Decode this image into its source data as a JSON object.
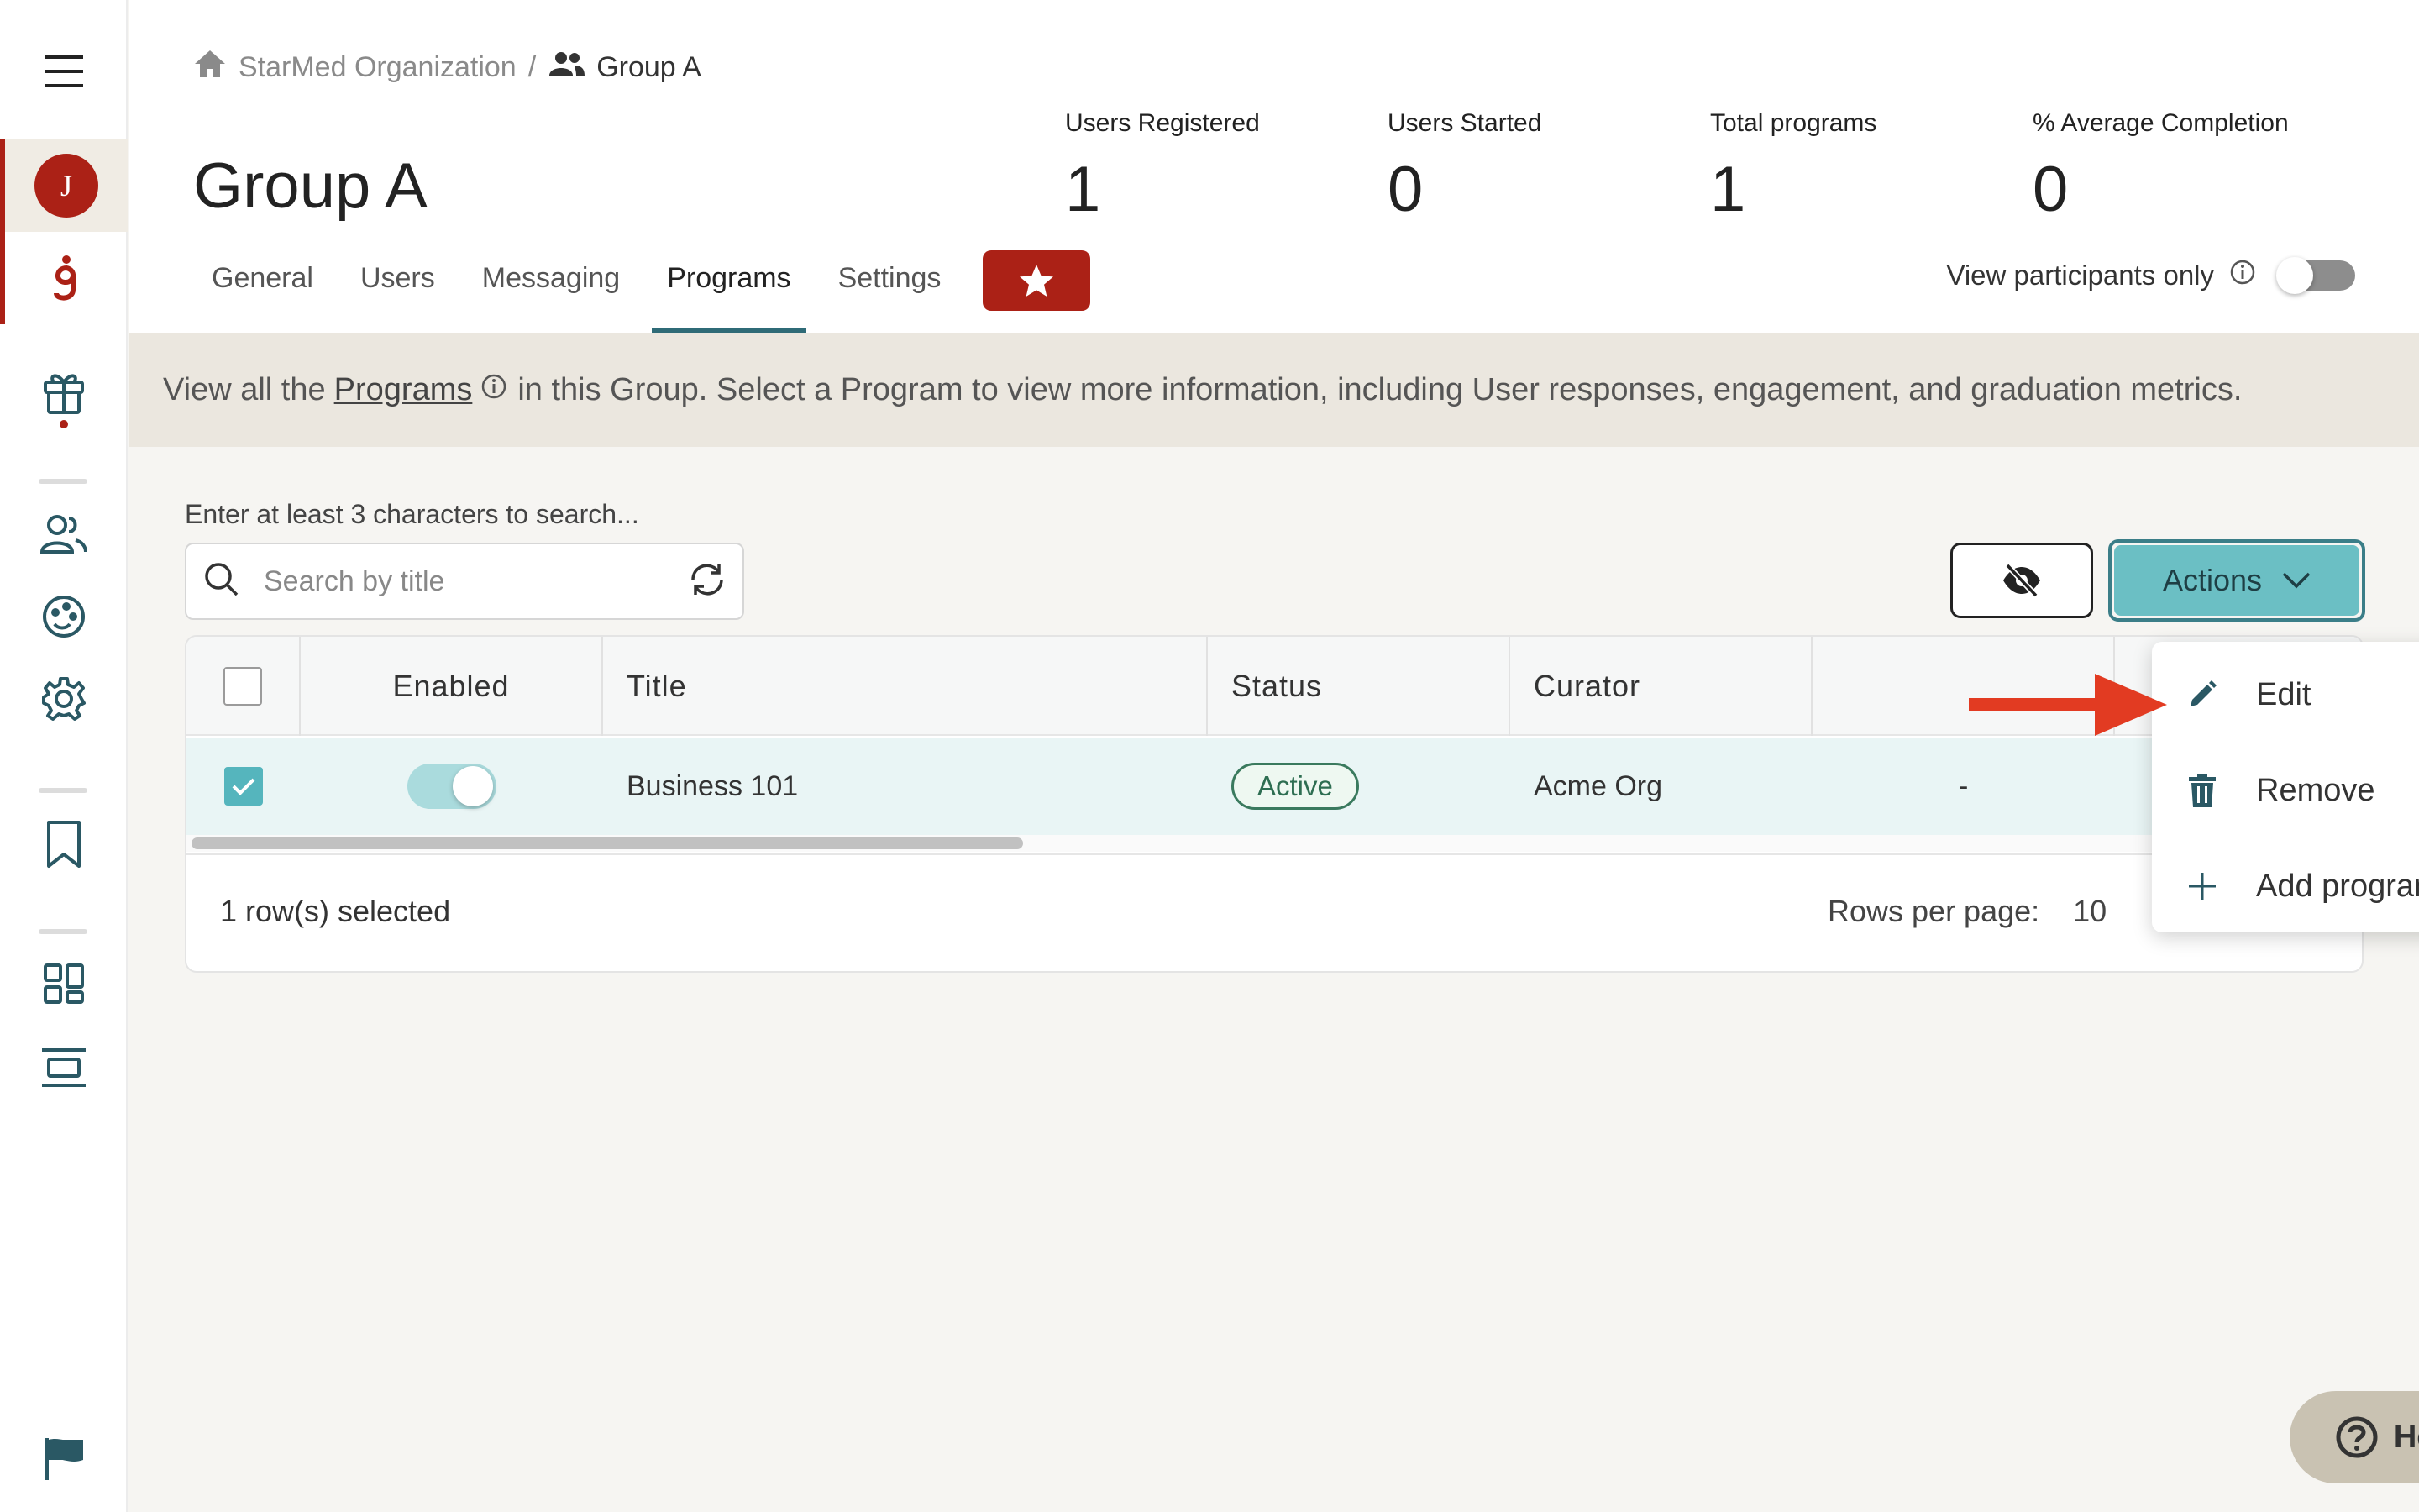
{
  "breadcrumb": {
    "org": "StarMed Organization",
    "separator": "/",
    "group": "Group A"
  },
  "page": {
    "title": "Group A"
  },
  "stats": [
    {
      "label": "Users Registered",
      "value": "1"
    },
    {
      "label": "Users Started",
      "value": "0"
    },
    {
      "label": "Total programs",
      "value": "1"
    },
    {
      "label": "% Average Completion",
      "value": "0"
    }
  ],
  "tabs": [
    {
      "label": "General"
    },
    {
      "label": "Users"
    },
    {
      "label": "Messaging"
    },
    {
      "label": "Programs",
      "active": true
    },
    {
      "label": "Settings"
    }
  ],
  "view_participants": {
    "label": "View participants only",
    "on": false
  },
  "banner": {
    "prefix": "View all the",
    "link": "Programs",
    "suffix": "in this Group. Select a Program to view more information, including User responses, engagement, and graduation metrics."
  },
  "search": {
    "hint": "Enter at least 3 characters to search...",
    "placeholder": "Search by title",
    "value": ""
  },
  "actions": {
    "label": "Actions"
  },
  "table": {
    "columns": [
      "Enabled",
      "Title",
      "Status",
      "Curator"
    ],
    "rows": [
      {
        "selected": true,
        "enabled": true,
        "title": "Business 101",
        "status": "Active",
        "curator": "Acme Org",
        "extra": "-"
      }
    ]
  },
  "footer": {
    "selected": "1 row(s) selected",
    "rows_per_page_label": "Rows per page:",
    "rows_per_page_value": "10"
  },
  "menu": {
    "items": [
      {
        "label": "Edit",
        "icon": "pencil-icon"
      },
      {
        "label": "Remove",
        "icon": "trash-icon"
      },
      {
        "label": "Add program",
        "icon": "plus-icon"
      }
    ]
  },
  "avatar": {
    "initial": "J"
  },
  "help": {
    "label": "Help"
  },
  "colors": {
    "brand_red": "#ab2116",
    "teal": "#6bbfc4",
    "teal_dark": "#2f6b77",
    "arrow": "#e23b22"
  }
}
